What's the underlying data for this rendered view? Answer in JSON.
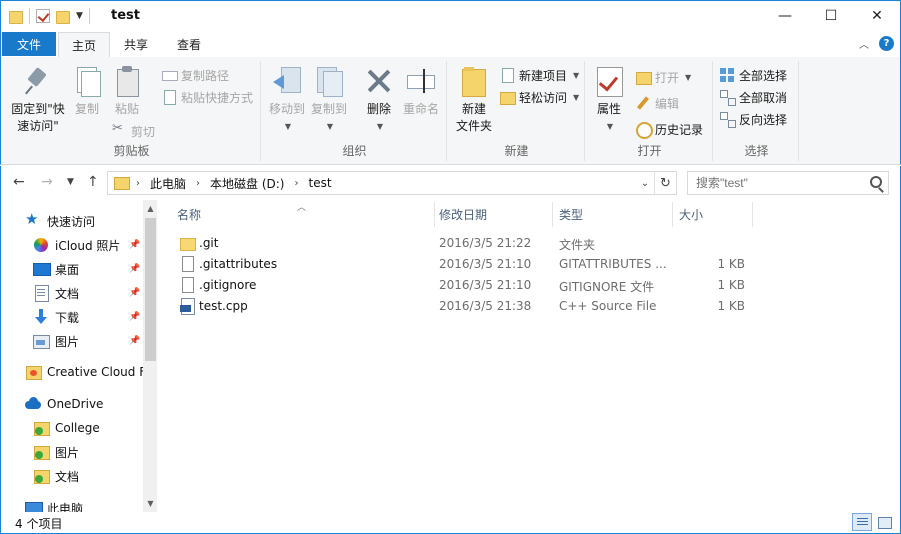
{
  "window": {
    "title": "test",
    "minimize": "—",
    "maximize": "☐",
    "close": "✕"
  },
  "ribbon_tabs": {
    "file": "文件",
    "home": "主页",
    "share": "共享",
    "view": "查看"
  },
  "ribbon": {
    "clipboard": {
      "label": "剪贴板",
      "pin_line1": "固定到\"快",
      "pin_line2": "速访问\"",
      "copy": "复制",
      "paste": "粘贴",
      "copy_path": "复制路径",
      "paste_shortcut": "粘贴快捷方式",
      "cut": "剪切"
    },
    "organize": {
      "label": "组织",
      "move_to": "移动到",
      "copy_to": "复制到",
      "delete": "删除",
      "rename": "重命名"
    },
    "new": {
      "label": "新建",
      "new_folder_line1": "新建",
      "new_folder_line2": "文件夹",
      "new_item": "新建项目",
      "easy_access": "轻松访问"
    },
    "open": {
      "label": "打开",
      "properties": "属性",
      "open": "打开",
      "edit": "编辑",
      "history": "历史记录"
    },
    "select": {
      "label": "选择",
      "select_all": "全部选择",
      "select_none": "全部取消",
      "invert": "反向选择"
    }
  },
  "address": {
    "crumbs": [
      "此电脑",
      "本地磁盘 (D:)",
      "test"
    ]
  },
  "search": {
    "placeholder": "搜索\"test\""
  },
  "nav": {
    "quick_access": "快速访问",
    "items": [
      {
        "label": "iCloud 照片",
        "pinned": true
      },
      {
        "label": "桌面",
        "pinned": true
      },
      {
        "label": "文档",
        "pinned": true
      },
      {
        "label": "下载",
        "pinned": true
      },
      {
        "label": "图片",
        "pinned": true
      }
    ],
    "creative_cloud": "Creative Cloud F",
    "onedrive": "OneDrive",
    "onedrive_items": [
      "College",
      "图片",
      "文档"
    ],
    "this_pc": "此电脑"
  },
  "columns": {
    "name": "名称",
    "date": "修改日期",
    "type": "类型",
    "size": "大小"
  },
  "files": [
    {
      "name": ".git",
      "date": "2016/3/5 21:22",
      "type": "文件夹",
      "size": "",
      "icon": "folder-icon"
    },
    {
      "name": ".gitattributes",
      "date": "2016/3/5 21:10",
      "type": "GITATTRIBUTES ...",
      "size": "1 KB",
      "icon": "file-icon"
    },
    {
      "name": ".gitignore",
      "date": "2016/3/5 21:10",
      "type": "GITIGNORE 文件",
      "size": "1 KB",
      "icon": "file-icon"
    },
    {
      "name": "test.cpp",
      "date": "2016/3/5 21:38",
      "type": "C++ Source File",
      "size": "1 KB",
      "icon": "cpp-file-icon"
    }
  ],
  "status": {
    "count": "4 个项目"
  }
}
